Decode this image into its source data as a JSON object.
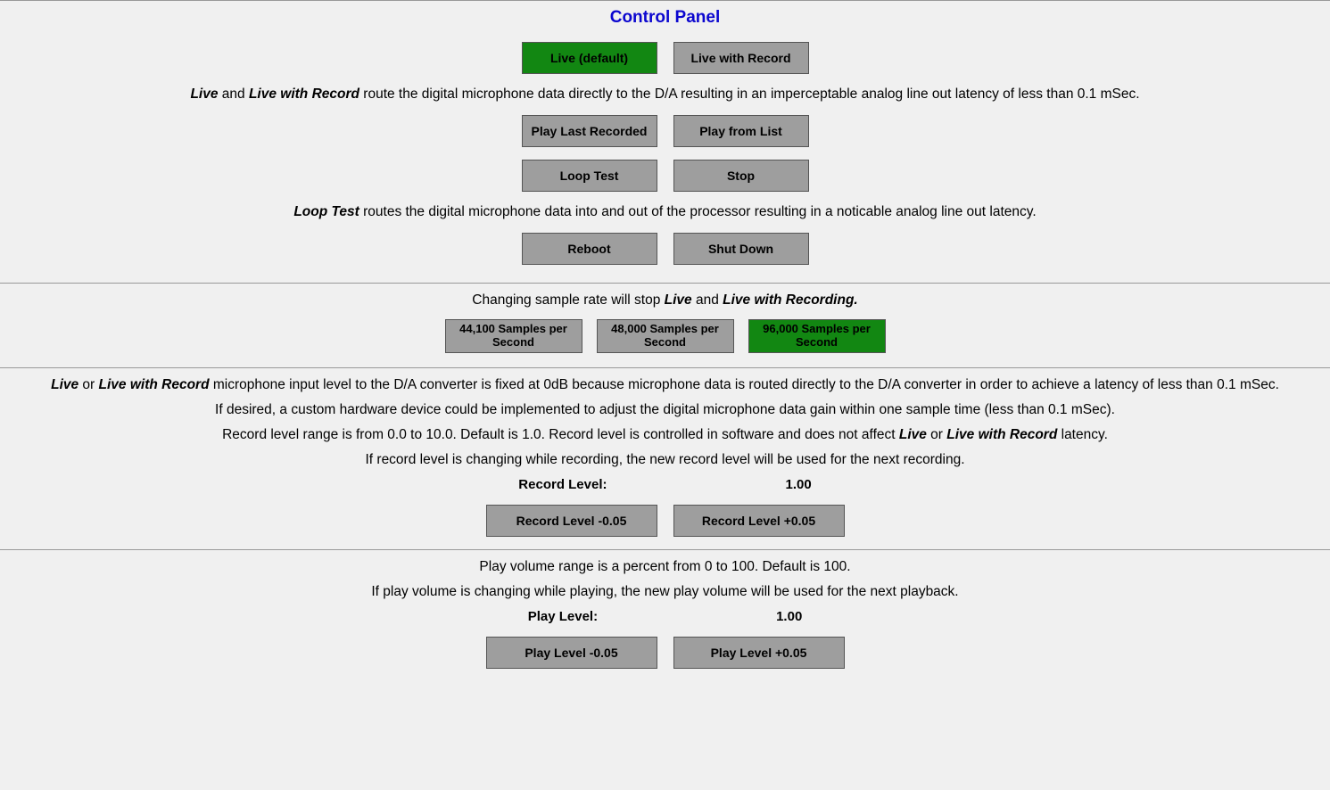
{
  "title": "Control Panel",
  "buttons": {
    "live": "Live (default)",
    "live_record": "Live with Record",
    "play_last": "Play Last Recorded",
    "play_list": "Play from List",
    "loop_test": "Loop Test",
    "stop": "Stop",
    "reboot": "Reboot",
    "shutdown": "Shut Down",
    "sample_44100": "44,100 Samples per Second",
    "sample_48000": "48,000 Samples per Second",
    "sample_96000": "96,000 Samples per Second",
    "rec_minus": "Record Level -0.05",
    "rec_plus": "Record Level +0.05",
    "play_minus": "Play Level -0.05",
    "play_plus": "Play Level +0.05"
  },
  "text": {
    "p1_a": "Live",
    "p1_b": " and ",
    "p1_c": "Live with Record",
    "p1_d": " route the digital microphone data directly to the D/A resulting in an imperceptable analog line out latency of less than 0.1 mSec.",
    "p2_a": "Loop Test",
    "p2_b": " routes the digital microphone data into and out of the processor resulting in a noticable analog line out latency.",
    "p3_a": "Changing sample rate will stop ",
    "p3_b": "Live",
    "p3_c": " and ",
    "p3_d": "Live with Recording.",
    "p4_a": "Live",
    "p4_b": " or ",
    "p4_c": "Live with Record",
    "p4_d": " microphone input level to the D/A converter is fixed at 0dB because microphone data is routed directly to the D/A converter in order to achieve a latency of less than 0.1 mSec.",
    "p5": "If desired, a custom hardware device could be implemented to adjust the digital microphone data gain within one sample time (less than 0.1 mSec).",
    "p6_a": "Record level range is from 0.0 to 10.0. Default is 1.0. Record level is controlled in software and does not affect ",
    "p6_b": "Live",
    "p6_c": " or ",
    "p6_d": "Live with Record",
    "p6_e": " latency.",
    "p7": "If record level is changing while recording, the new record level will be used for the next recording.",
    "p8": "Play volume range is a percent from 0 to 100. Default is 100.",
    "p9": "If play volume is changing while playing, the new play volume will be used for the next playback."
  },
  "labels": {
    "record_level": "Record Level:",
    "play_level": "Play Level:"
  },
  "values": {
    "record_level": "1.00",
    "play_level": "1.00"
  }
}
